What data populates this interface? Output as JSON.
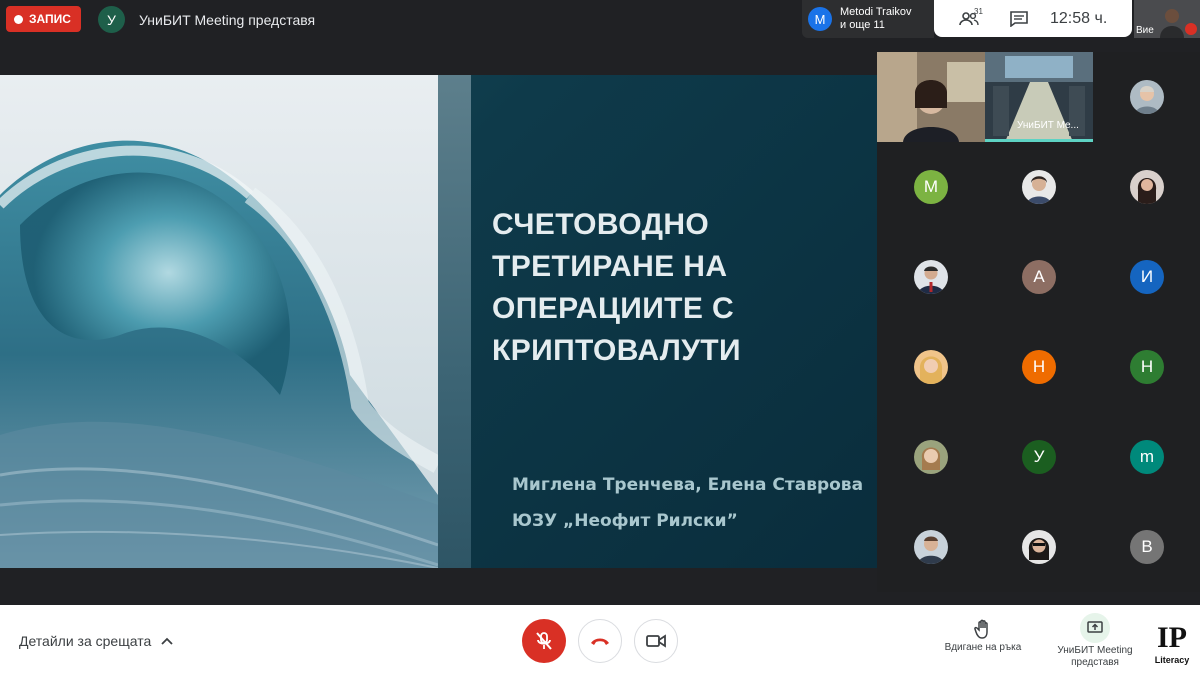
{
  "topbar": {
    "record_label": "ЗАПИС",
    "presenter_initial": "У",
    "presenter_text": "УниБИТ Meeting представя",
    "speaker_initial": "M",
    "speaker_name": "Metodi Traikov",
    "speaker_more": "и още 11",
    "participants_count": "31",
    "time": "12:58 ч.",
    "self_label": "Вие"
  },
  "slide": {
    "title": "СЧЕТОВОДНО ТРЕТИРАНЕ НА ОПЕРАЦИИТЕ С КРИПТОВАЛУТИ",
    "authors": "Миглена Тренчева, Елена Ставрова",
    "university": "ЮЗУ „Неофит Рилски”"
  },
  "grid": {
    "video_label": "УниБИТ Me...",
    "tiles": [
      {
        "initial": "M",
        "color": "#7cb342"
      },
      {
        "initial": "А",
        "color": "#8d6e63"
      },
      {
        "initial": "И",
        "color": "#1565c0"
      },
      {
        "initial": "Н",
        "color": "#ef6c00"
      },
      {
        "initial": "Н",
        "color": "#2e7d32"
      },
      {
        "initial": "У",
        "color": "#1b5e20"
      },
      {
        "initial": "m",
        "color": "#00897b"
      },
      {
        "initial": "B",
        "color": "#757575"
      }
    ]
  },
  "bottombar": {
    "details_label": "Детайли за срещата",
    "raise_hand_label": "Вдигане на ръка",
    "present_label_1": "УниБИТ Meeting",
    "present_label_2": "представя",
    "logo_text": "IP",
    "logo_sub": "Literacy"
  },
  "colors": {
    "red": "#d93025",
    "dark_bg": "#202124",
    "slide_bg": "#0e3a4a"
  }
}
